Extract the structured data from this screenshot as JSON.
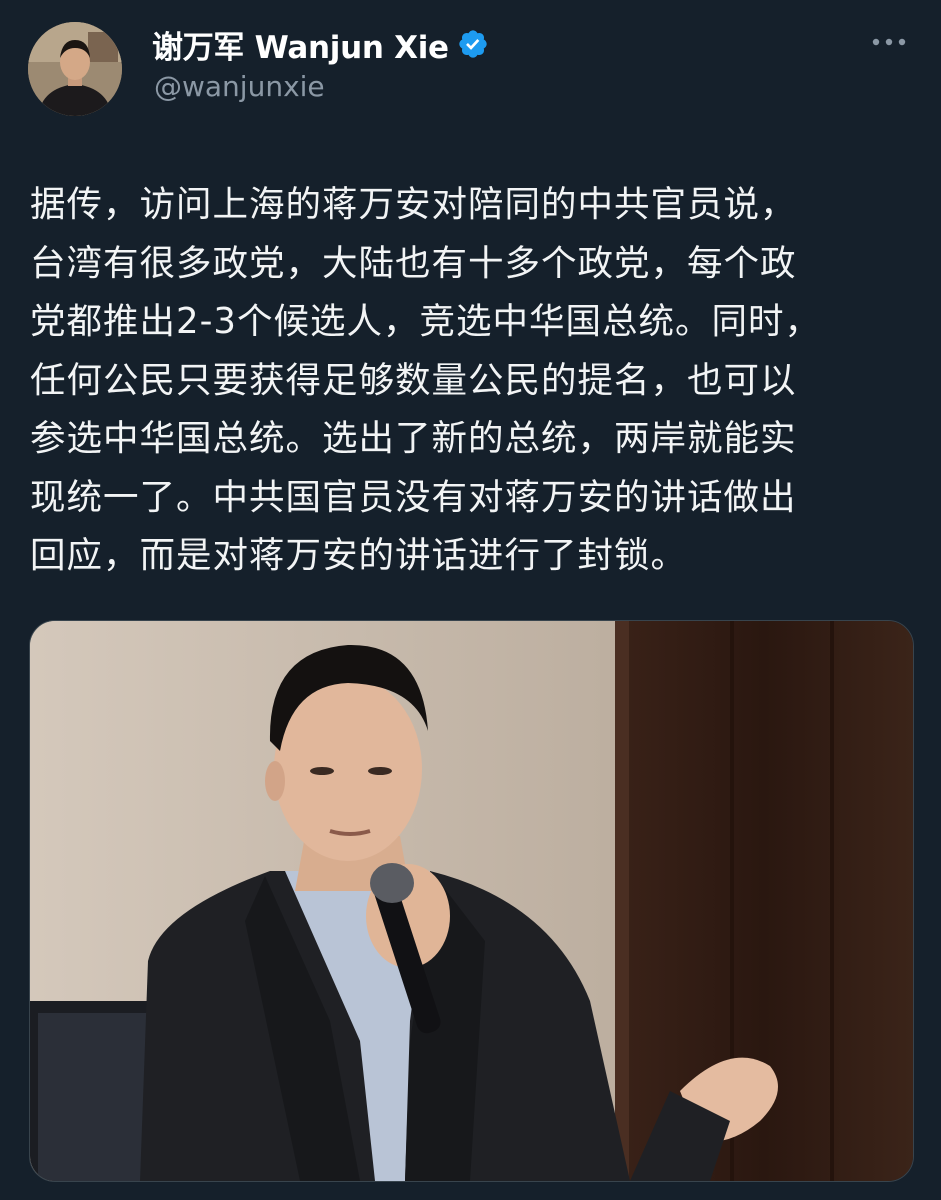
{
  "author": {
    "display_name": "谢万军 Wanjun Xie",
    "handle": "@wanjunxie",
    "verified": true,
    "avatar": "profile-photo"
  },
  "more_icon": "more-horizontal-icon",
  "tweet": {
    "lines": [
      "据传，访问上海的蒋万安对陪同的中共官员说，",
      "台湾有很多政党，大陆也有十多个政党，每个政",
      "党都推出2-3个候选人，竞选中华国总统。同时，",
      "任何公民只要获得足够数量公民的提名，也可以",
      "参选中华国总统。选出了新的总统，两岸就能实",
      "现统一了。中共国官员没有对蒋万安的讲话做出",
      "回应，而是对蒋万安的讲话进行了封锁。"
    ]
  },
  "media": {
    "image": "photo-man-in-suit-speaking-into-microphone"
  },
  "colors": {
    "background": "#15202b",
    "text": "#f2f4f5",
    "secondary": "#8b98a5",
    "verified": "#1d9bf0"
  }
}
